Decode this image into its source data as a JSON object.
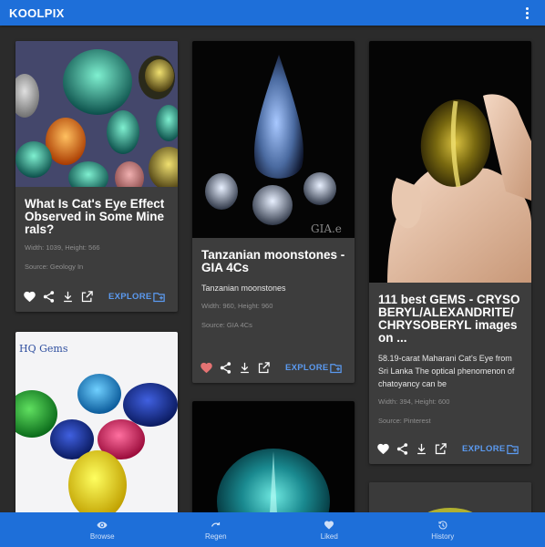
{
  "app": {
    "title": "KOOLPIX"
  },
  "cards": [
    {
      "title": "What Is Cat's Eye Effect Observed in Some Minerals?",
      "description": "",
      "dimensions": "Width: 1039, Height: 566",
      "source": "Source: Geology In",
      "liked": false,
      "explore_label": "EXPLORE"
    },
    {
      "title": "Tanzanian moonstones - GIA 4Cs",
      "description": "Tanzanian moonstones",
      "dimensions": "Width: 960, Height: 960",
      "source": "Source: GIA 4Cs",
      "liked": true,
      "explore_label": "EXPLORE",
      "watermark": "GIA.e"
    },
    {
      "title": "111 best GEMS - CRYSOBERYL/ALEXANDRITE/CHRYSOBERYL images on ...",
      "description": "58.19-carat Maharani Cat's Eye from Sri Lanka The optical phenomenon of chatoyancy can be",
      "dimensions": "Width: 394, Height: 600",
      "source": "Source: Pinterest",
      "liked": false,
      "explore_label": "EXPLORE"
    },
    {
      "watermark": "HQ Gems"
    }
  ],
  "nav": [
    {
      "label": "Browse",
      "icon": "eye-icon"
    },
    {
      "label": "Regen",
      "icon": "regen-icon"
    },
    {
      "label": "Liked",
      "icon": "heart-icon"
    },
    {
      "label": "History",
      "icon": "history-icon"
    }
  ],
  "colors": {
    "primary": "#1e6fd9",
    "background": "#2b2b2b",
    "card": "#3d3d3d",
    "accent": "#5b9af0",
    "liked": "#e57373"
  }
}
